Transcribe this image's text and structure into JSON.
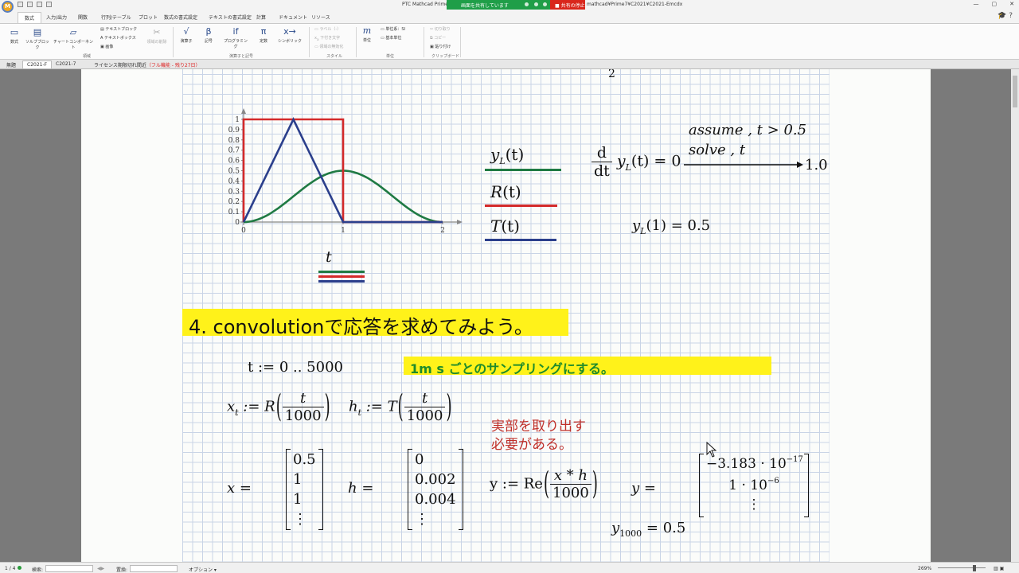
{
  "titlebar": {
    "app_title": "PTC Mathcad Prime",
    "share_status": "画面を共有しています",
    "stop_share": "共有の停止",
    "path": "mathcad¥Prime7¥C2021¥C2021-Emcdx",
    "logo": "M"
  },
  "ribbon_tabs": [
    "数式",
    "入力/出力",
    "関数",
    "行列/テーブル",
    "プロット",
    "数式の書式設定",
    "テキストの書式設定",
    "計算",
    "ドキュメント",
    "リソース"
  ],
  "ribbon": {
    "math": "数式",
    "solve_block": "ソルブブロック",
    "chart": "チャートコンポーネント",
    "text_block": "テキストブロック",
    "text_box": "テキストボックス",
    "image": "画像",
    "delete_region": "領域の削除",
    "group_regions": "領域",
    "operators": "演算子",
    "symbols": "記号",
    "programming": "プログラミング",
    "constants": "定数",
    "symbolic": "シンボリック",
    "group_operators": "演算子と記号",
    "label": "ラベル（-）",
    "subscript": "下付き文字",
    "disable_region": "領域の無効化",
    "group_style": "スタイル",
    "units": "単位",
    "unit_system": "単位系：SI",
    "base_units": "基本単位",
    "group_units": "単位",
    "cut": "切り取り",
    "copy": "コピー",
    "paste": "貼り付け",
    "group_clipboard": "クリップボード"
  },
  "doc_tabs": [
    "無題",
    "C2021-F",
    "C2021-7"
  ],
  "license": {
    "text": "ライセンス期限切れ間近",
    "warn": "（フル機能 - 残り27日）"
  },
  "chart_data": {
    "type": "line",
    "xlim": [
      0,
      2
    ],
    "ylim": [
      0,
      1
    ],
    "x_ticks": [
      "0",
      "1",
      "2"
    ],
    "y_ticks": [
      "0",
      "0.1",
      "0.2",
      "0.3",
      "0.4",
      "0.5",
      "0.6",
      "0.7",
      "0.8",
      "0.9",
      "1"
    ],
    "xlabel": "t",
    "series": [
      {
        "name": "y_L(t)",
        "color": "#1f7a43",
        "x": [
          0,
          0.25,
          0.5,
          0.75,
          1,
          1.25,
          1.5,
          1.75,
          2
        ],
        "y": [
          0,
          0.07,
          0.25,
          0.43,
          0.5,
          0.43,
          0.25,
          0.07,
          0
        ]
      },
      {
        "name": "R(t)",
        "color": "#d42a2a",
        "x": [
          0,
          0,
          1,
          1,
          2
        ],
        "y": [
          0,
          1,
          1,
          0,
          0
        ]
      },
      {
        "name": "T(t)",
        "color": "#2b3f8c",
        "x": [
          0,
          0.5,
          1,
          2
        ],
        "y": [
          0,
          1,
          0,
          0
        ]
      }
    ]
  },
  "legend": {
    "yL_base": "y",
    "yL_sub": "L",
    "yL_arg": "(t)",
    "R": "R",
    "R_arg": "(t)",
    "T": "T",
    "T_arg": "(t)"
  },
  "math": {
    "top_fraction": "2",
    "deriv_d": "d",
    "deriv_dt": "dt",
    "deriv_y": "y",
    "deriv_sub": "L",
    "deriv_arg": "(t) = 0",
    "assume": "assume , t > 0.5",
    "solve": "solve , t",
    "result": "1.0",
    "yl1_base": "y",
    "yl1_sub": "L",
    "yl1_rest": "(1) = 0.5",
    "t_range": "t := 0 .. 5000",
    "x_def_lhs": "x",
    "x_def_sub": "t",
    "x_def_fn": " := R",
    "x_def_num": "t",
    "x_def_den": "1000",
    "h_def_lhs": "h",
    "h_def_sub": "t",
    "h_def_fn": " := T",
    "h_def_num": "t",
    "h_def_den": "1000",
    "x_eq": "x =",
    "x_vals": [
      "0.5",
      "1",
      "1",
      "⋮"
    ],
    "h_eq": "h =",
    "h_vals": [
      "0",
      "0.002",
      "0.004",
      "⋮"
    ],
    "y_def_fn": "y := Re",
    "y_def_num": "x * h",
    "y_def_den": "1000",
    "y_eq": "y =",
    "y_val1_mant": "−3.183 · 10",
    "y_val1_exp": "−17",
    "y_val2_mant": "1 · 10",
    "y_val2_exp": "−6",
    "y_val3": "⋮",
    "y1000_base": "y",
    "y1000_sub": "1000",
    "y1000_rest": " = 0.5"
  },
  "heading": "4.   convolutionで応答を求めてみよう。",
  "note": "1m s ごとのサンプリングにする。",
  "red_note": [
    "実部を取り出す",
    "必要がある。"
  ],
  "statusbar": {
    "page": "1 / 4",
    "search": "検索:",
    "replace": "置換:",
    "options": "オプション",
    "zoom": "269%"
  },
  "colors": {
    "accent_green": "#1f9e48",
    "stop_red": "#d9261c",
    "highlight": "#fff21a"
  }
}
